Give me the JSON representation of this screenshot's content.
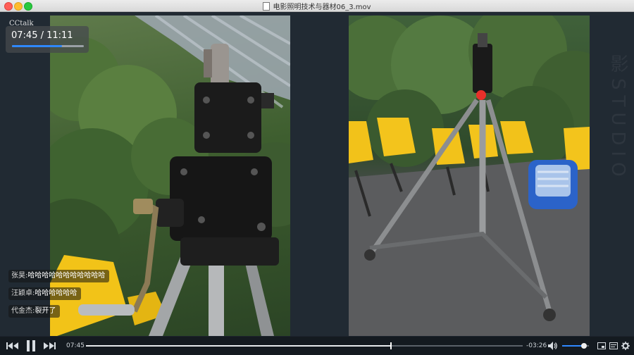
{
  "window": {
    "title": "电影照明技术与器材06_3.mov"
  },
  "overlay": {
    "logo": "CCtalk",
    "time_display": "07:45 / 11:11",
    "progress_fraction": 0.697
  },
  "chat_messages": [
    {
      "name": "张昊:",
      "text": "哈哈哈哈哈哈哈哈哈哈哈"
    },
    {
      "name": "汪颖卓:",
      "text": "哈哈哈哈哈哈"
    },
    {
      "name": "代金杰:",
      "text": "裂开了"
    }
  ],
  "player": {
    "current_time": "07:45",
    "remaining_time": "-03:26",
    "progress_fraction": 0.697,
    "volume_fraction": 0.82
  },
  "icons": {
    "rewind": "rewind-icon",
    "pause": "pause-icon",
    "forward": "fast-forward-icon",
    "volume": "volume-icon",
    "pip": "picture-in-picture-icon",
    "subtitles": "subtitles-icon",
    "settings": "gear-icon"
  },
  "colors": {
    "accent": "#2f88ff",
    "chrome": "#141a20"
  }
}
